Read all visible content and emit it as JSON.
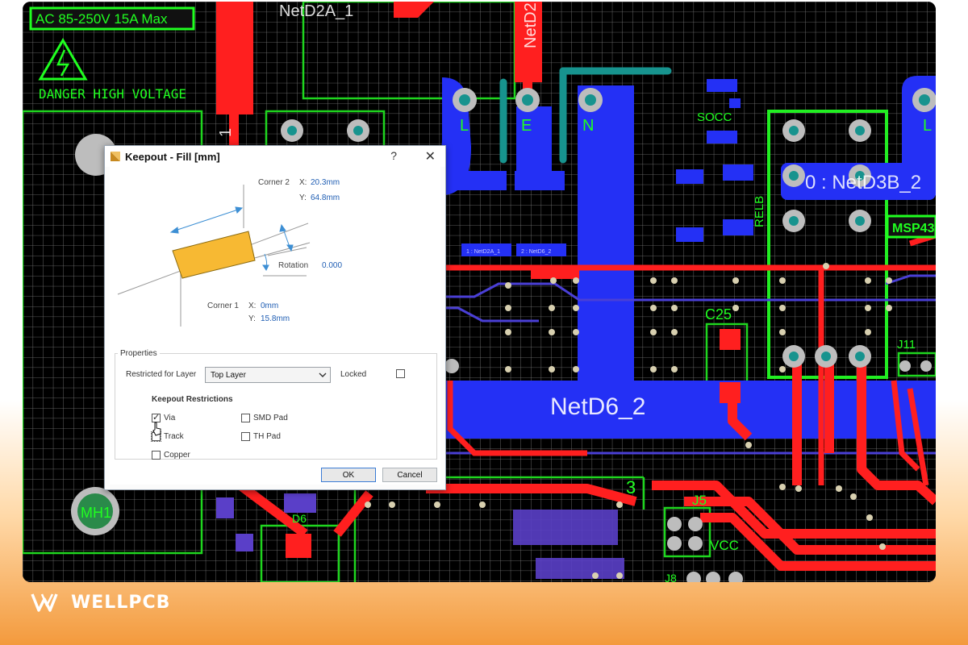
{
  "pcb": {
    "warning_label": "AC 85-250V 15A Max",
    "danger_label": "DANGER HIGH VOLTAGE",
    "net_top_left": "NetD2A_1",
    "net_top_mid": "NetD2",
    "net_big": "NetD6_2",
    "net_right": "0 : NetD3B_2",
    "pin_L": "L",
    "pin_E": "E",
    "pin_N": "N",
    "pin_L2": "L",
    "socc": "SOCC",
    "relb": "RELB",
    "msp": "MSP43",
    "c25": "C25",
    "j11": "J11",
    "mh1": "MH1",
    "j5": "J5",
    "vcc": "VCC",
    "num3": "3",
    "pad_label_a": "1 : NetD2A_1",
    "pad_label_b": "2 : NetD6_2",
    "pad_num_2": "2",
    "pad_num_1": "1",
    "d6": "D6",
    "j8": "J8"
  },
  "dialog": {
    "title": "Keepout - Fill [mm]",
    "help": "?",
    "close": "✕",
    "corner2_label": "Corner 2",
    "corner2_x_label": "X:",
    "corner2_x": "20.3mm",
    "corner2_y_label": "Y:",
    "corner2_y": "64.8mm",
    "rotation_label": "Rotation",
    "rotation_value": "0.000",
    "corner1_label": "Corner 1",
    "corner1_x_label": "X:",
    "corner1_x": "0mm",
    "corner1_y_label": "Y:",
    "corner1_y": "15.8mm",
    "properties_label": "Properties",
    "restricted_label": "Restricted for Layer",
    "layer_value": "Top Layer",
    "locked_label": "Locked",
    "restrictions_title": "Keepout Restrictions",
    "opt_via": "Via",
    "opt_track": "Track",
    "opt_copper": "Copper",
    "opt_smd": "SMD Pad",
    "opt_th": "TH Pad",
    "ok": "OK",
    "cancel": "Cancel",
    "checked": {
      "via": true,
      "track": false,
      "copper": false,
      "smd": false,
      "th": false,
      "locked": false
    }
  },
  "brand": {
    "name": "WELLPCB"
  },
  "colors": {
    "grid": "#7f7f7f",
    "top_copper": "#ff1f1f",
    "bottom_copper": "#1f2cff",
    "silkscreen": "#20ff20",
    "keepout_fill": "#f7b933",
    "teal": "#15948d",
    "value_blue": "#1e5db3"
  }
}
